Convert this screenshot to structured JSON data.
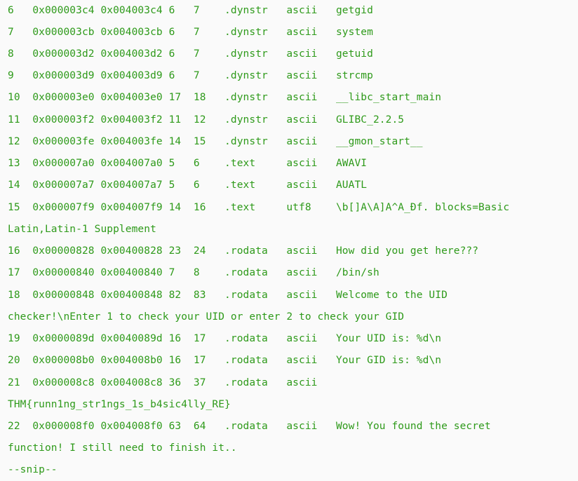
{
  "output": {
    "lines": [
      "6   0x000003c4 0x004003c4 6   7    .dynstr   ascii   getgid",
      "7   0x000003cb 0x004003cb 6   7    .dynstr   ascii   system",
      "8   0x000003d2 0x004003d2 6   7    .dynstr   ascii   getuid",
      "9   0x000003d9 0x004003d9 6   7    .dynstr   ascii   strcmp",
      "10  0x000003e0 0x004003e0 17  18   .dynstr   ascii   __libc_start_main",
      "11  0x000003f2 0x004003f2 11  12   .dynstr   ascii   GLIBC_2.2.5",
      "12  0x000003fe 0x004003fe 14  15   .dynstr   ascii   __gmon_start__",
      "13  0x000007a0 0x004007a0 5   6    .text     ascii   AWAVI",
      "14  0x000007a7 0x004007a7 5   6    .text     ascii   AUATL",
      "15  0x000007f9 0x004007f9 14  16   .text     utf8    \\b[]A\\A]A^A_Ðf. blocks=Basic",
      "Latin,Latin-1 Supplement",
      "16  0x00000828 0x00400828 23  24   .rodata   ascii   How did you get here???",
      "17  0x00000840 0x00400840 7   8    .rodata   ascii   /bin/sh",
      "18  0x00000848 0x00400848 82  83   .rodata   ascii   Welcome to the UID",
      "checker!\\nEnter 1 to check your UID or enter 2 to check your GID",
      "19  0x0000089d 0x0040089d 16  17   .rodata   ascii   Your UID is: %d\\n",
      "20  0x000008b0 0x004008b0 16  17   .rodata   ascii   Your GID is: %d\\n",
      "21  0x000008c8 0x004008c8 36  37   .rodata   ascii",
      "THM{runn1ng_str1ngs_1s_b4sic4lly_RE}",
      "22  0x000008f0 0x004008f0 63  64   .rodata   ascii   Wow! You found the secret",
      "function! I still need to finish it..",
      "--snip--"
    ]
  }
}
